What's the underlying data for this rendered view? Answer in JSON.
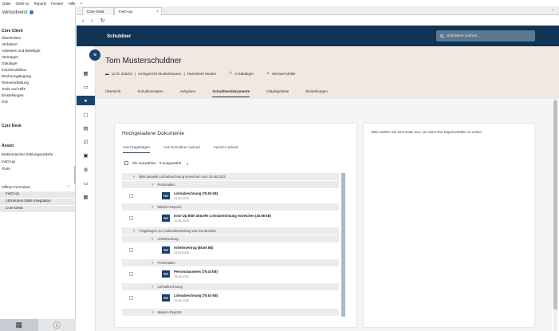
{
  "menubar": [
    "Datei",
    "Gehe zu",
    "Reports",
    "Fenster",
    "Hilfe",
    "?"
  ],
  "left_panel": {
    "logo": "winsolvenz",
    "core_client_title": "Core Client",
    "core_client_items": [
      "Übersichten",
      "Verfahren",
      "Adressen und Beteiligte",
      "Vermögen",
      "Gläubiger",
      "Insolvenzbilanz",
      "Rechnungslegung",
      "Textverarbeitung",
      "Tools und Hilfe",
      "Einstellungen",
      "GIS"
    ],
    "core_desk_title": "Core Desk",
    "assist_title": "Assist",
    "assist_items": [
      "Elektronischer Zahlungsverkehr",
      "InsO-Up",
      "Tools"
    ],
    "offene_formulare_title": "Offene Formulare",
    "offene_formulare_items": [
      "InsO-Up",
      "LEXolution.DMS Integration",
      "Core Desk"
    ]
  },
  "browser": {
    "tabs": [
      "Core Desk",
      "InsO-Up"
    ],
    "close_glyph": "×",
    "chevron_glyph": "⌄",
    "nav": {
      "back": "‹",
      "forward": "›",
      "reload": "↻"
    }
  },
  "header": {
    "title": "Schuldner",
    "search_placeholder": "Schuldner suchen..."
  },
  "person": {
    "name": "Tom Musterschuldner",
    "aktenzeichen": "12 IK 345/23",
    "gericht": "Amtsgericht Musterhausen",
    "verwalter": "Hannelore Muster",
    "glaeubiger": "2 Gläubiger",
    "bearbeiter": "Michael Müller",
    "separator": "|"
  },
  "tabs": [
    "Übersicht",
    "Schuldnerdaten",
    "Aufgaben",
    "Schuldnerdokumente",
    "Gläubigerliste",
    "Einstellungen"
  ],
  "active_tab_index": 3,
  "documents": {
    "title": "Hochgeladene Dokumente",
    "upload_tabs": [
      "Aus Fragebögen",
      "Aus Schuldner Upload",
      "Kanzlei Upload"
    ],
    "select_all": "Alle auswählen",
    "selected_count": "0 ausgewählt",
    "empty_hint": "Bitte wählen Sie eine Datei aus, um seine Ihre Eigenschaften zu sehen."
  },
  "tree": {
    "pdf_label": "PDF",
    "group_1": "Bitte aktuelle Lohnabrechnung einreichen vom 19.06.2023",
    "group_1_sub_1": "Personalien",
    "doc_1_name": "Lohnabrechnung (78.63 kB)",
    "doc_1_date": "19.06.2023",
    "group_1_sub_2": "Mission Reports",
    "doc_2_name": "InsO-Up Bitte aktuelle Lohnabrechnung einreichen (40.98 kB)",
    "doc_2_date": "19.06.2023",
    "group_2": "Fragebogen zur Auskunftserteilung vom 19.06.2023",
    "group_2_sub_1": "Arbeitsvertrag",
    "doc_3_name": "Arbeitsvertrag (88.65 kB)",
    "doc_3_date": "19.06.2023",
    "group_2_sub_2": "Personalien",
    "doc_4_name": "Personalausweis (79.44 kB)",
    "doc_4_date": "19.06.2023",
    "group_2_sub_3": "Lohnabrechnung",
    "doc_5_name": "Lohnabrechnung (78.63 kB)",
    "doc_5_date": "19.06.2023",
    "group_2_sub_4": "Mission Reports"
  },
  "colors": {
    "header_dark": "#0f3454",
    "accent": "#17446d",
    "person_band": "#f1e7e3"
  }
}
